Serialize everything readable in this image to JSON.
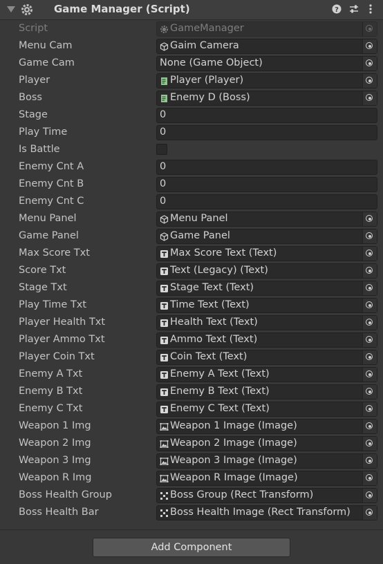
{
  "header": {
    "title": "Game Manager (Script)",
    "icons": [
      "help-icon",
      "preset-icon",
      "more-icon"
    ]
  },
  "rows": [
    {
      "label": "Script",
      "kind": "object",
      "value": "GameManager",
      "icon": "script-icon",
      "disabled": true
    },
    {
      "label": "Menu Cam",
      "kind": "object",
      "value": "Gaim Camera",
      "icon": "gameobject-icon"
    },
    {
      "label": "Game Cam",
      "kind": "object",
      "value": "None (Game Object)",
      "icon": ""
    },
    {
      "label": "Player",
      "kind": "object",
      "value": "Player (Player)",
      "icon": "script-asset-icon"
    },
    {
      "label": "Boss",
      "kind": "object",
      "value": "Enemy D (Boss)",
      "icon": "script-asset-icon"
    },
    {
      "label": "Stage",
      "kind": "number",
      "value": "0"
    },
    {
      "label": "Play Time",
      "kind": "number",
      "value": "0"
    },
    {
      "label": "Is Battle",
      "kind": "bool",
      "value": false
    },
    {
      "label": "Enemy Cnt A",
      "kind": "number",
      "value": "0"
    },
    {
      "label": "Enemy Cnt B",
      "kind": "number",
      "value": "0"
    },
    {
      "label": "Enemy Cnt C",
      "kind": "number",
      "value": "0"
    },
    {
      "label": "Menu Panel",
      "kind": "object",
      "value": "Menu Panel",
      "icon": "gameobject-icon"
    },
    {
      "label": "Game Panel",
      "kind": "object",
      "value": "Game Panel",
      "icon": "gameobject-icon"
    },
    {
      "label": "Max Score Txt",
      "kind": "object",
      "value": "Max Score Text (Text)",
      "icon": "text-icon"
    },
    {
      "label": "Score Txt",
      "kind": "object",
      "value": "Text (Legacy) (Text)",
      "icon": "text-icon"
    },
    {
      "label": "Stage Txt",
      "kind": "object",
      "value": "Stage Text (Text)",
      "icon": "text-icon"
    },
    {
      "label": "Play Time Txt",
      "kind": "object",
      "value": "Time Text (Text)",
      "icon": "text-icon"
    },
    {
      "label": "Player Health Txt",
      "kind": "object",
      "value": "Health Text (Text)",
      "icon": "text-icon"
    },
    {
      "label": "Player Ammo Txt",
      "kind": "object",
      "value": "Ammo Text (Text)",
      "icon": "text-icon"
    },
    {
      "label": "Player Coin Txt",
      "kind": "object",
      "value": "Coin Text (Text)",
      "icon": "text-icon"
    },
    {
      "label": "Enemy A Txt",
      "kind": "object",
      "value": "Enemy A Text (Text)",
      "icon": "text-icon"
    },
    {
      "label": "Enemy B Txt",
      "kind": "object",
      "value": "Enemy B Text (Text)",
      "icon": "text-icon"
    },
    {
      "label": "Enemy C Txt",
      "kind": "object",
      "value": "Enemy C Text (Text)",
      "icon": "text-icon"
    },
    {
      "label": "Weapon 1 Img",
      "kind": "object",
      "value": "Weapon 1 Image (Image)",
      "icon": "image-icon"
    },
    {
      "label": "Weapon 2 Img",
      "kind": "object",
      "value": "Weapon 2 Image (Image)",
      "icon": "image-icon"
    },
    {
      "label": "Weapon 3 Img",
      "kind": "object",
      "value": "Weapon 3 Image (Image)",
      "icon": "image-icon"
    },
    {
      "label": "Weapon R Img",
      "kind": "object",
      "value": "Weapon R Image (Image)",
      "icon": "image-icon"
    },
    {
      "label": "Boss Health Group",
      "kind": "object",
      "value": "Boss Group (Rect Transform)",
      "icon": "rect-transform-icon"
    },
    {
      "label": "Boss Health Bar",
      "kind": "object",
      "value": "Boss Health Image (Rect Transform)",
      "icon": "rect-transform-icon"
    }
  ],
  "footer": {
    "add_component_label": "Add Component"
  }
}
